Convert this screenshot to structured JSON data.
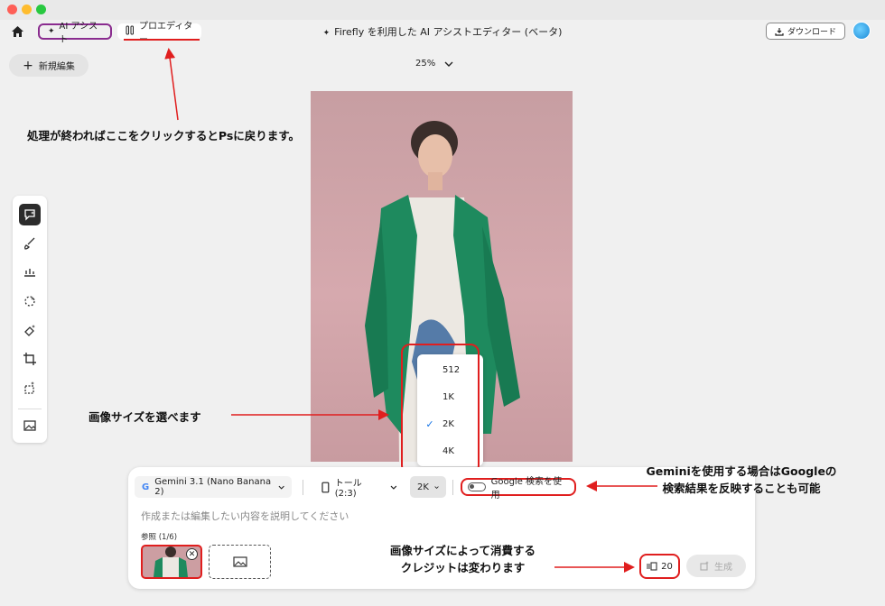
{
  "header": {
    "tab_ai_assist": "AI アシスト",
    "tab_pro_editor": "プロエディター",
    "title": "Firefly を利用した AI アシストエディター (ベータ)",
    "download_label": "ダウンロード"
  },
  "toolbar": {
    "new_edit_label": "新規編集",
    "zoom_label": "25%"
  },
  "prompt_panel": {
    "model_label": "Gemini 3.1 (Nano Banana 2)",
    "aspect_label": "トール (2:3)",
    "size_label": "2K",
    "google_search_label": "Google 検索を使用",
    "prompt_placeholder": "作成または編集したい内容を説明してください",
    "reference_label": "参照 (1/6)",
    "credits": "20",
    "generate_label": "生成"
  },
  "size_dropdown": {
    "options": [
      "512",
      "1K",
      "2K",
      "4K"
    ],
    "selected": "2K"
  },
  "annotations": {
    "return_to_ps": "処理が終わればここをクリックするとPsに戻ります。",
    "choose_size": "画像サイズを選べます",
    "gemini_google_line1": "Geminiを使用する場合はGoogleの",
    "gemini_google_line2": "検索結果を反映することも可能",
    "credits_line1": "画像サイズによって消費する",
    "credits_line2": "クレジットは変わります"
  },
  "colors": {
    "annotation_red": "#e01e1e",
    "accent_green": "#1e8a5e",
    "tab_purple": "#8a2c8f"
  }
}
